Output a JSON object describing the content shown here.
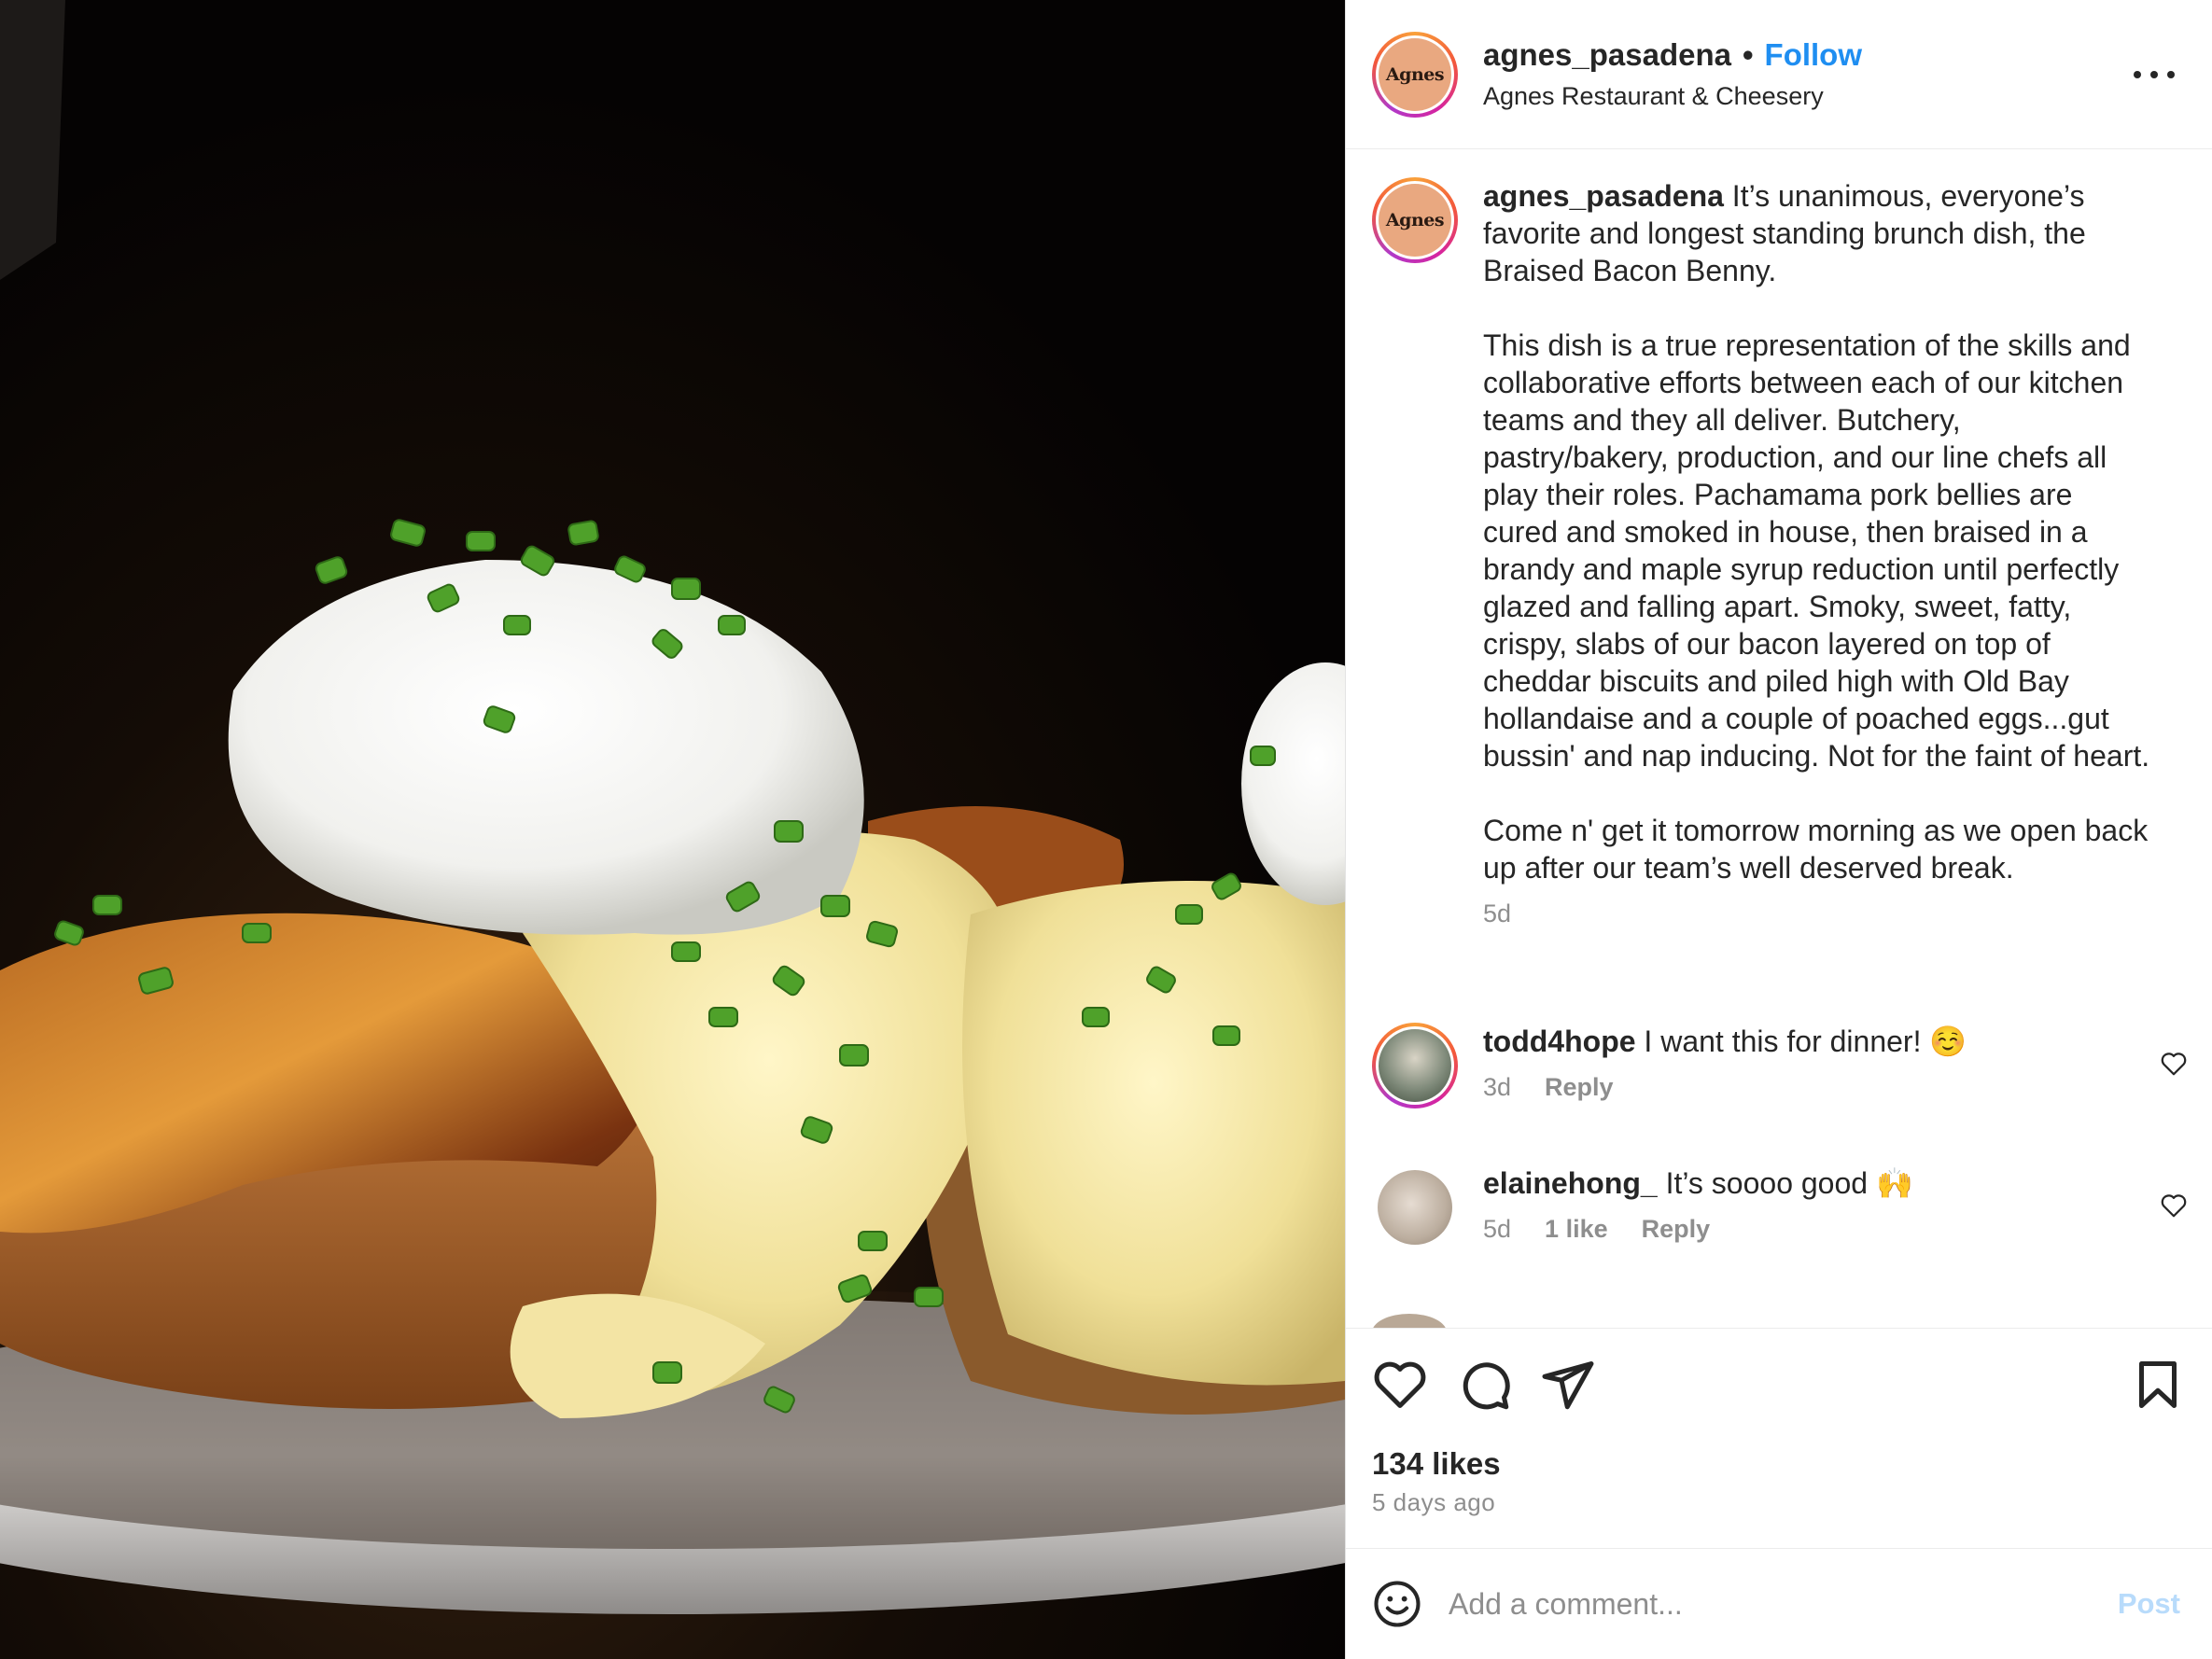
{
  "post": {
    "author": "agnes_pasadena",
    "location": "Agnes Restaurant & Cheesery",
    "follow_label": "Follow",
    "separator": "•",
    "avatar_text": "Agnes",
    "more_icon": "more-horizontal-icon"
  },
  "caption": {
    "user": "agnes_pasadena",
    "text": "It’s unanimous, everyone’s favorite and longest standing brunch dish, the Braised Bacon Benny.\n\nThis dish is a true representation of the skills and collaborative efforts between each of our kitchen teams and they all deliver. Butchery, pastry/bakery, production, and our line chefs all play their roles. Pachamama pork bellies are cured and smoked in house, then braised in a brandy and maple syrup reduction until perfectly glazed and falling apart. Smoky, sweet, fatty, crispy, slabs of our bacon layered on top of cheddar biscuits and piled high with Old Bay hollandaise and a couple of poached eggs...gut bussin' and nap inducing. Not for the faint of heart.\n\nCome n' get it tomorrow morning as we open back up after our team’s well deserved break.",
    "time": "5d"
  },
  "comments": [
    {
      "user": "todd4hope",
      "text": "I want this for dinner! ☺️",
      "time": "3d",
      "likes": "",
      "reply": "Reply"
    },
    {
      "user": "elainehong_",
      "text": "It’s soooo good 🙌",
      "time": "5d",
      "likes": "1 like",
      "reply": "Reply"
    }
  ],
  "actions": {
    "icons": [
      "heart-icon",
      "comment-icon",
      "share-icon",
      "bookmark-icon"
    ],
    "likes": "134 likes",
    "posted": "5 days ago"
  },
  "composer": {
    "emoji_icon": "emoji-icon",
    "placeholder": "Add a comment...",
    "post_label": "Post"
  },
  "colors": {
    "follow": "#1f8ef1",
    "post_disabled": "#b8dbfb",
    "muted": "#8e8e8e",
    "text": "#262626"
  }
}
